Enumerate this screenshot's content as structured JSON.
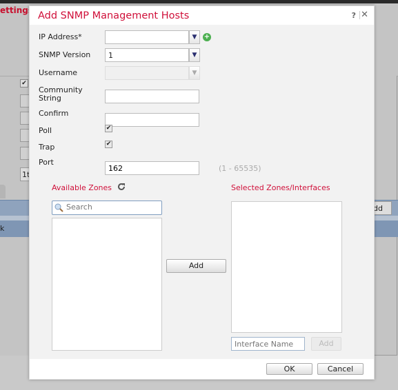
{
  "background": {
    "title_fragment": "ettings",
    "select_fragment": "1t",
    "button_fragment": "dd",
    "row_fragment": "k"
  },
  "dialog": {
    "title": "Add SNMP Management Hosts",
    "help_icon": "question-icon",
    "close_icon": "close-icon",
    "fields": {
      "ip_address": {
        "label": "IP Address*",
        "value": ""
      },
      "snmp_version": {
        "label": "SNMP Version",
        "value": "1"
      },
      "username": {
        "label": "Username",
        "value": "",
        "disabled": true
      },
      "community_string": {
        "label_line1": "Community",
        "label_line2": "String",
        "value": ""
      },
      "confirm": {
        "label": "Confirm",
        "value": ""
      },
      "poll": {
        "label": "Poll",
        "checked": true
      },
      "trap": {
        "label": "Trap",
        "checked": true
      },
      "port": {
        "label": "Port",
        "value": "162",
        "hint": "(1 - 65535)"
      }
    },
    "available_zones": {
      "title": "Available Zones",
      "search_placeholder": "Search",
      "items": []
    },
    "add_button": "Add",
    "selected_zones": {
      "title": "Selected Zones/Interfaces",
      "items": [],
      "interface_placeholder": "Interface Name",
      "add_button": "Add",
      "add_disabled": true
    },
    "ok_button": "OK",
    "cancel_button": "Cancel"
  },
  "colors": {
    "accent": "#d0103a",
    "add_icon": "#4caf50"
  }
}
